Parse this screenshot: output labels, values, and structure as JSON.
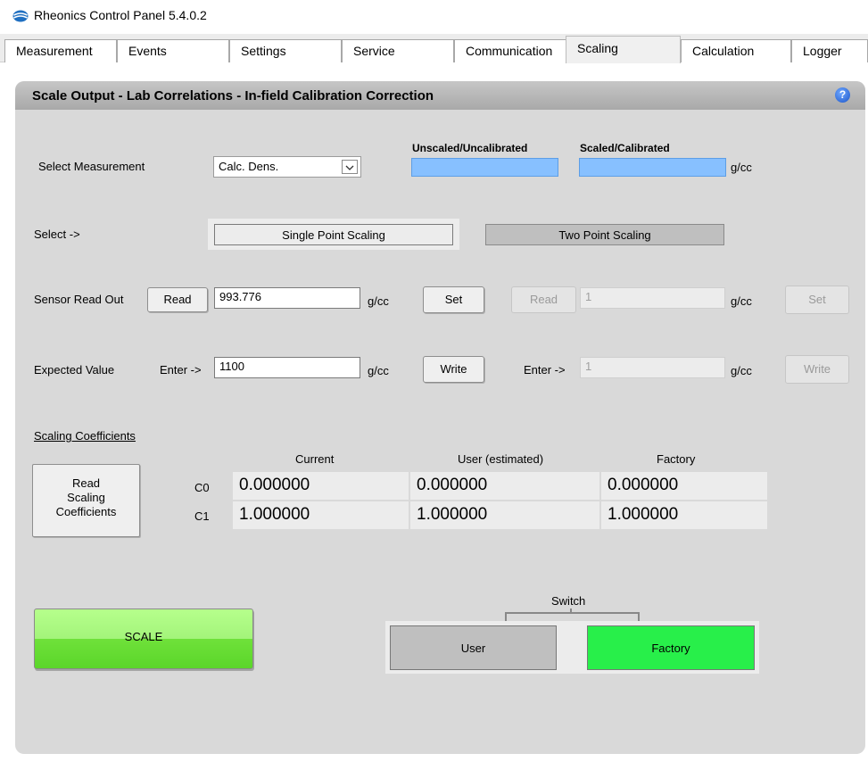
{
  "window": {
    "title": "Rheonics Control Panel 5.4.0.2"
  },
  "tabs": [
    "Measurement",
    "Events",
    "Settings",
    "Service",
    "Communication",
    "Scaling",
    "Calculation",
    "Logger"
  ],
  "panel": {
    "title": "Scale Output - Lab Correlations - In-field Calibration Correction",
    "help": "?"
  },
  "measurement": {
    "label": "Select Measurement",
    "selected": "Calc. Dens.",
    "unscaled_label": "Unscaled/Uncalibrated",
    "scaled_label": "Scaled/Calibrated",
    "unit": "g/cc"
  },
  "select": {
    "label": "Select ->",
    "single": "Single Point Scaling",
    "two": "Two Point Scaling"
  },
  "sensor": {
    "label": "Sensor Read Out",
    "read": "Read",
    "value": "993.776",
    "unit": "g/cc",
    "set": "Set",
    "read2": "Read",
    "value2": "1",
    "unit2": "g/cc",
    "set2": "Set"
  },
  "expected": {
    "label": "Expected Value",
    "enter": "Enter ->",
    "value": "1100",
    "unit": "g/cc",
    "write": "Write",
    "enter2": "Enter ->",
    "value2": "1",
    "unit2": "g/cc",
    "write2": "Write"
  },
  "coefficients": {
    "title": "Scaling Coefficients",
    "read_button": "Read\nScaling\nCoefficients",
    "headers": [
      "Current",
      "User (estimated)",
      "Factory"
    ],
    "rows": [
      {
        "name": "C0",
        "values": [
          "0.000000",
          "0.000000",
          "0.000000"
        ]
      },
      {
        "name": "C1",
        "values": [
          "1.000000",
          "1.000000",
          "1.000000"
        ]
      }
    ]
  },
  "scale_button": "SCALE",
  "switch": {
    "label": "Switch",
    "user": "User",
    "factory": "Factory"
  },
  "colors": {
    "scaled_field": "#87c0ff",
    "factory_active": "#28ef4a",
    "scale_button": "#7ee64a"
  }
}
